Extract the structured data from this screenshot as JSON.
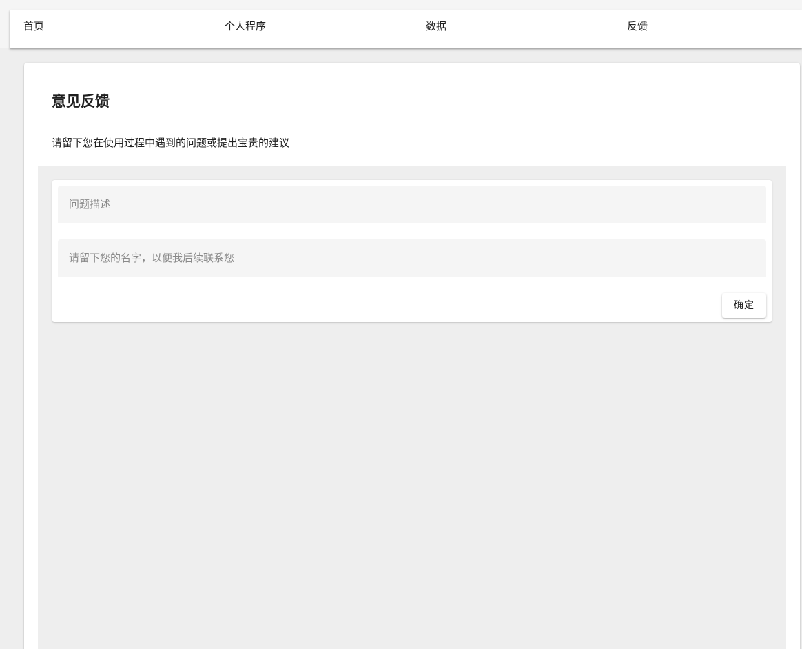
{
  "nav": {
    "items": [
      {
        "label": "首页"
      },
      {
        "label": "个人程序"
      },
      {
        "label": "数据"
      },
      {
        "label": "反馈"
      }
    ]
  },
  "feedback": {
    "title": "意见反馈",
    "subtitle": "请留下您在使用过程中遇到的问题或提出宝贵的建议",
    "fields": [
      {
        "placeholder": "问题描述",
        "value": ""
      },
      {
        "placeholder": "请留下您的名字，以便我后续联系您",
        "value": ""
      }
    ],
    "submit_label": "确定"
  }
}
